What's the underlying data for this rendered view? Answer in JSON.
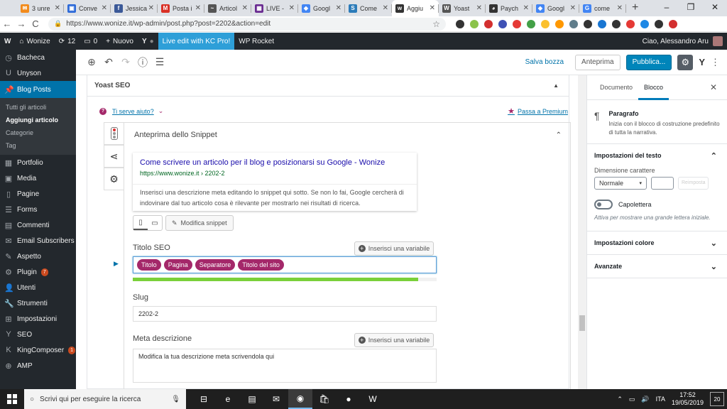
{
  "browser": {
    "tabs": [
      {
        "title": "3 unre",
        "color": "#f28b1c",
        "glyph": "✉"
      },
      {
        "title": "Conve",
        "color": "#2d6ad8",
        "glyph": "▣"
      },
      {
        "title": "Jessica",
        "color": "#3b5998",
        "glyph": "f"
      },
      {
        "title": "Posta i",
        "color": "#d93025",
        "glyph": "M"
      },
      {
        "title": "Articol",
        "color": "#555555",
        "glyph": "~"
      },
      {
        "title": "LIVE -",
        "color": "#6a2c91",
        "glyph": "▦"
      },
      {
        "title": "Googl",
        "color": "#4285f4",
        "glyph": "◆"
      },
      {
        "title": "Come",
        "color": "#2b7bb9",
        "glyph": "S"
      },
      {
        "title": "Aggiu",
        "color": "#333333",
        "glyph": "w",
        "active": true
      },
      {
        "title": "Yoast",
        "color": "#555555",
        "glyph": "W"
      },
      {
        "title": "Paych",
        "color": "#333333",
        "glyph": "◕"
      },
      {
        "title": "Googl",
        "color": "#4285f4",
        "glyph": "◆"
      },
      {
        "title": "come",
        "color": "#4285f4",
        "glyph": "G"
      }
    ],
    "new_tab": "+",
    "window_controls": [
      "–",
      "❐",
      "✕"
    ],
    "nav": {
      "back": "←",
      "forward": "→",
      "reload": "C"
    },
    "url": "https://www.wonize.it/wp-admin/post.php?post=2202&action=edit",
    "lock_icon": "🔒",
    "star_icon": "☆",
    "extension_colors": [
      "#333333",
      "#8bc34a",
      "#d32f2f",
      "#3f51b5",
      "#e53935",
      "#43a047",
      "#fbc02d",
      "#ff9800",
      "#607d8b",
      "#333333",
      "#1976d2",
      "#333333",
      "#e53935",
      "#1e88e5",
      "#333333",
      "#d32f2f"
    ]
  },
  "adminbar": {
    "wp_logo": "W",
    "site": "Wonize",
    "updates": "12",
    "comments": "0",
    "new": "Nuovo",
    "yoast": "Y",
    "kc": "Live edit with KC Pro!",
    "rocket": "WP Rocket",
    "greeting": "Ciao, Alessandro Aru"
  },
  "menu": {
    "items_top": [
      {
        "icon": "◷",
        "label": "Bacheca"
      },
      {
        "icon": "U",
        "label": "Unyson"
      }
    ],
    "current": {
      "icon": "📌",
      "label": "Blog Posts"
    },
    "submenu": [
      "Tutti gli articoli",
      "Aggiungi articolo",
      "Categorie",
      "Tag"
    ],
    "items_bottom": [
      {
        "icon": "▦",
        "label": "Portfolio"
      },
      {
        "icon": "▣",
        "label": "Media"
      },
      {
        "icon": "▯",
        "label": "Pagine"
      },
      {
        "icon": "☰",
        "label": "Forms"
      },
      {
        "icon": "▤",
        "label": "Commenti"
      },
      {
        "icon": "✉",
        "label": "Email Subscribers"
      },
      {
        "icon": "✎",
        "label": "Aspetto"
      },
      {
        "icon": "⚙",
        "label": "Plugin",
        "badge": "7"
      },
      {
        "icon": "👤",
        "label": "Utenti"
      },
      {
        "icon": "🔧",
        "label": "Strumenti"
      },
      {
        "icon": "⊞",
        "label": "Impostazioni"
      },
      {
        "icon": "Y",
        "label": "SEO"
      },
      {
        "icon": "K",
        "label": "KingComposer",
        "badge": "1"
      },
      {
        "icon": "⊕",
        "label": "AMP"
      }
    ]
  },
  "toolbar": {
    "add": "⊕",
    "undo": "↶",
    "redo": "↷",
    "info": "ⓘ",
    "outline": "☰",
    "save_draft": "Salva bozza",
    "preview": "Anteprima",
    "publish": "Pubblica...",
    "settings": "⚙",
    "yoast": "Y",
    "more": "⋮"
  },
  "yoast": {
    "box_title": "Yoast SEO",
    "collapse": "▲",
    "help_icon": "?",
    "help_text": "Ti serve aiuto?",
    "help_chevron": "⌄",
    "premium_star": "★",
    "premium_text": "Passa a Premium",
    "snippet_title": "Anteprima dello Snippet",
    "snippet_chevron": "⌃",
    "serp": {
      "title": "Come scrivere un articolo per il blog e posizionarsi su Google - Wonize",
      "url": "https://www.wonize.it › 2202-2",
      "description": "Inserisci una descrizione meta editando lo snippet qui sotto. Se non lo fai, Google cercherà di indovinare dal tuo articolo cosa è rilevante per mostrarlo nei risultati di ricerca."
    },
    "mobile_icon": "▯",
    "desktop_icon": "▭",
    "edit_icon": "✎",
    "edit_snippet": "Modifica snippet",
    "seo_title_label": "Titolo SEO",
    "insert_variable": "Inserisci una variabile",
    "insert_variable_icon": "+",
    "pills": [
      "Titolo",
      "Pagina",
      "Separatore",
      "Titolo del sito"
    ],
    "seo_title_progress": 0.94,
    "slug_label": "Slug",
    "slug_value": "2202-2",
    "meta_label": "Meta descrizione",
    "meta_placeholder": "Modifica la tua descrizione meta scrivendola qui",
    "vtab_share": "⋖",
    "vtab_gear": "⚙",
    "active_marker": "▶"
  },
  "sidebar": {
    "tab_document": "Documento",
    "tab_block": "Blocco",
    "close": "✕",
    "block_icon": "¶",
    "block_title": "Paragrafo",
    "block_desc": "Inizia con il blocco di costruzione predefinito di tutta la narrativa.",
    "text_settings": "Impostazioni del testo",
    "font_size_label": "Dimensione carattere",
    "font_size_value": "Normale",
    "reset": "Reimposta",
    "dropcap_label": "Capolettera",
    "dropcap_help": "Attiva per mostrare una grande lettera iniziale.",
    "color_settings": "Impostazioni colore",
    "advanced": "Avanzate",
    "chev_up": "⌃",
    "chev_down": "⌄",
    "dropdown": "▾"
  },
  "taskbar": {
    "search_placeholder": "Scrivi qui per eseguire la ricerca",
    "search_icon": "○",
    "mic_icon": "🎙",
    "apps": [
      {
        "glyph": "⊟",
        "name": "task-view-icon"
      },
      {
        "glyph": "e",
        "name": "edge-icon"
      },
      {
        "glyph": "▤",
        "name": "file-explorer-icon"
      },
      {
        "glyph": "✉",
        "name": "mail-icon"
      },
      {
        "glyph": "◉",
        "name": "chrome-icon",
        "active": true
      },
      {
        "glyph": "🛍",
        "name": "store-icon"
      },
      {
        "glyph": "●",
        "name": "spotify-icon"
      },
      {
        "glyph": "W",
        "name": "word-icon"
      }
    ],
    "tray_icons": [
      "⌃",
      "▭",
      "🔊"
    ],
    "language": "ITA",
    "time": "17:52",
    "date": "19/05/2019",
    "notifications": "20"
  }
}
